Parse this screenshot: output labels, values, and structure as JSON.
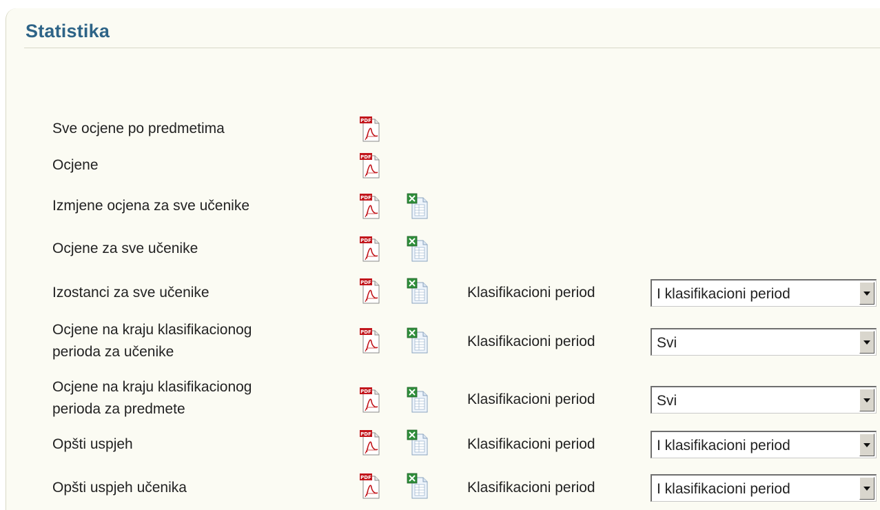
{
  "page": {
    "title": "Statistika"
  },
  "reports": [
    {
      "label": "Sve ocjene po predmetima",
      "pdf": true,
      "excel": false
    },
    {
      "label": "Ocjene",
      "pdf": true,
      "excel": false
    },
    {
      "label": "Izmjene ocjena za sve učenike",
      "pdf": true,
      "excel": true
    },
    {
      "label": "Ocjene za sve učenike",
      "pdf": true,
      "excel": true
    },
    {
      "label": "Izostanci za sve učenike",
      "pdf": true,
      "excel": true,
      "period_label": "Klasifikacioni period",
      "period_value": "I klasifikacioni period"
    },
    {
      "label_line1": "Ocjene na kraju klasifikacionog",
      "label_line2": "perioda za učenike",
      "pdf": true,
      "excel": true,
      "period_label": "Klasifikacioni period",
      "period_value": "Svi"
    },
    {
      "label_line1": "Ocjene na kraju klasifikacionog",
      "label_line2": "perioda za predmete",
      "pdf": true,
      "excel": true,
      "period_label": "Klasifikacioni period",
      "period_value": "Svi"
    },
    {
      "label": "Opšti uspjeh",
      "pdf": true,
      "excel": true,
      "period_label": "Klasifikacioni period",
      "period_value": "I klasifikacioni period"
    },
    {
      "label": "Opšti uspjeh učenika",
      "pdf": true,
      "excel": true,
      "period_label": "Klasifikacioni period",
      "period_value": "I klasifikacioni period"
    }
  ],
  "icons": {
    "pdf": "pdf-file-icon",
    "excel": "excel-file-icon"
  },
  "colors": {
    "title": "#2e6487",
    "panel_background": "#fbfbf3"
  }
}
